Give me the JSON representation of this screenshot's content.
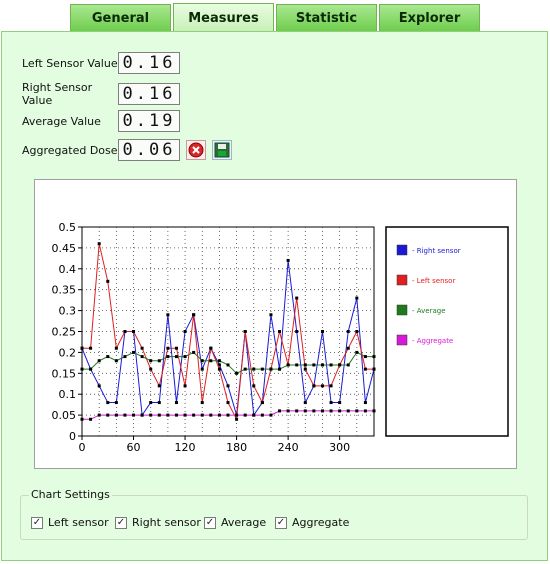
{
  "tabs": [
    {
      "label": "General",
      "active": false
    },
    {
      "label": "Measures",
      "active": true
    },
    {
      "label": "Statistic",
      "active": false
    },
    {
      "label": "Explorer",
      "active": false
    }
  ],
  "readings": {
    "left": {
      "label": "Left Sensor Value",
      "value": "0.16"
    },
    "right": {
      "label": "Right Sensor Value",
      "value": "0.16"
    },
    "average": {
      "label": "Average Value",
      "value": "0.19"
    },
    "dose": {
      "label": "Aggregated Dose",
      "value": "0.06"
    }
  },
  "icons": {
    "reset": "red-x-icon",
    "save": "save-icon"
  },
  "settings": {
    "title": "Chart Settings",
    "left": "Left sensor",
    "right": "Right sensor",
    "average": "Average",
    "aggregate": "Aggregate"
  },
  "colors": {
    "right": "#1a1ad6",
    "left": "#e02020",
    "average": "#1f7a1f",
    "aggregate": "#d81ad8",
    "panel": "#e3fde0",
    "tab": "#6fcd4e"
  },
  "chart_data": {
    "type": "line",
    "x": [
      0,
      10,
      20,
      30,
      40,
      50,
      60,
      70,
      80,
      90,
      100,
      110,
      120,
      130,
      140,
      150,
      160,
      170,
      180,
      190,
      200,
      210,
      220,
      230,
      240,
      250,
      260,
      270,
      280,
      290,
      300,
      310,
      320,
      330,
      340
    ],
    "xlim": [
      0,
      340
    ],
    "ylim": [
      0,
      0.5
    ],
    "xticks": [
      0,
      60,
      120,
      180,
      240,
      300
    ],
    "yticks": [
      0,
      0.05,
      0.1,
      0.15,
      0.2,
      0.25,
      0.3,
      0.35,
      0.4,
      0.45,
      0.5
    ],
    "grid": true,
    "legend_position": "right",
    "series": [
      {
        "name": "- Right sensor",
        "color": "#1a1ad6",
        "values": [
          0.21,
          0.16,
          0.12,
          0.08,
          0.08,
          0.25,
          0.25,
          0.05,
          0.08,
          0.08,
          0.29,
          0.08,
          0.25,
          0.29,
          0.16,
          0.21,
          0.17,
          0.12,
          0.05,
          0.25,
          0.05,
          0.08,
          0.29,
          0.16,
          0.42,
          0.25,
          0.08,
          0.12,
          0.25,
          0.08,
          0.08,
          0.25,
          0.33,
          0.08,
          0.16
        ]
      },
      {
        "name": "- Left sensor",
        "color": "#e02020",
        "values": [
          0.21,
          0.21,
          0.46,
          0.37,
          0.21,
          0.25,
          0.25,
          0.21,
          0.16,
          0.12,
          0.21,
          0.21,
          0.12,
          0.29,
          0.08,
          0.21,
          0.16,
          0.08,
          0.04,
          0.25,
          0.12,
          0.08,
          0.16,
          0.25,
          0.17,
          0.33,
          0.16,
          0.12,
          0.12,
          0.12,
          0.17,
          0.21,
          0.25,
          0.16,
          0.16
        ]
      },
      {
        "name": "- Average",
        "color": "#1f7a1f",
        "values": [
          0.16,
          0.16,
          0.18,
          0.19,
          0.18,
          0.19,
          0.2,
          0.19,
          0.18,
          0.18,
          0.19,
          0.19,
          0.19,
          0.2,
          0.18,
          0.18,
          0.18,
          0.17,
          0.15,
          0.16,
          0.16,
          0.16,
          0.16,
          0.16,
          0.17,
          0.17,
          0.17,
          0.17,
          0.17,
          0.17,
          0.17,
          0.17,
          0.2,
          0.19,
          0.19
        ]
      },
      {
        "name": "- Aggregate",
        "color": "#d81ad8",
        "values": [
          0.04,
          0.04,
          0.05,
          0.05,
          0.05,
          0.05,
          0.05,
          0.05,
          0.05,
          0.05,
          0.05,
          0.05,
          0.05,
          0.05,
          0.05,
          0.05,
          0.05,
          0.05,
          0.05,
          0.05,
          0.05,
          0.05,
          0.05,
          0.06,
          0.06,
          0.06,
          0.06,
          0.06,
          0.06,
          0.06,
          0.06,
          0.06,
          0.06,
          0.06,
          0.06
        ]
      }
    ]
  }
}
